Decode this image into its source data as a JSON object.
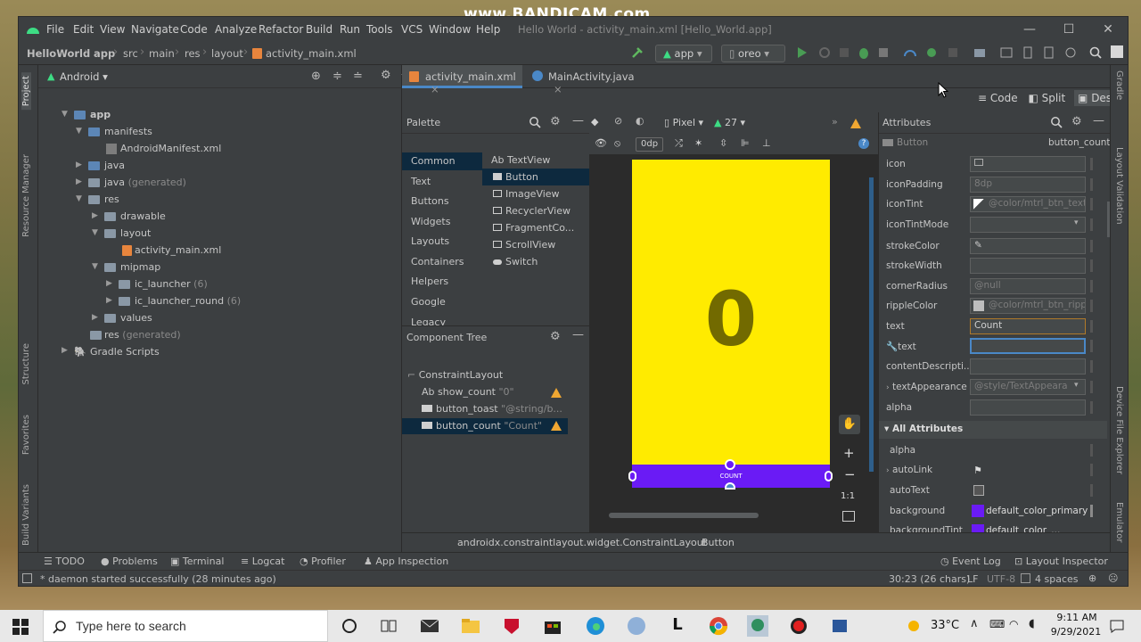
{
  "watermark": "www.BANDICAM.com",
  "window": {
    "title": "Hello World - activity_main.xml [Hello_World.app]"
  },
  "menu": [
    "File",
    "Edit",
    "View",
    "Navigate",
    "Code",
    "Analyze",
    "Refactor",
    "Build",
    "Run",
    "Tools",
    "VCS",
    "Window",
    "Help"
  ],
  "breadcrumb": [
    "HelloWorld",
    "app",
    "src",
    "main",
    "res",
    "layout",
    "activity_main.xml"
  ],
  "run_config": "app",
  "device": "oreo",
  "project": {
    "view": "Android",
    "tree": [
      {
        "label": "app",
        "sub": ""
      },
      {
        "label": "manifests",
        "sub": ""
      },
      {
        "label": "AndroidManifest.xml",
        "sub": ""
      },
      {
        "label": "java",
        "sub": ""
      },
      {
        "label": "java",
        "sub": "(generated)"
      },
      {
        "label": "res",
        "sub": ""
      },
      {
        "label": "drawable",
        "sub": ""
      },
      {
        "label": "layout",
        "sub": ""
      },
      {
        "label": "activity_main.xml",
        "sub": ""
      },
      {
        "label": "mipmap",
        "sub": ""
      },
      {
        "label": "ic_launcher",
        "sub": "(6)"
      },
      {
        "label": "ic_launcher_round",
        "sub": "(6)"
      },
      {
        "label": "values",
        "sub": ""
      },
      {
        "label": "res",
        "sub": "(generated)"
      },
      {
        "label": "Gradle Scripts",
        "sub": ""
      }
    ]
  },
  "left_tool_tabs": [
    "Project",
    "Resource Manager",
    "Structure",
    "Favorites",
    "Build Variants"
  ],
  "right_tool_tabs": [
    "Gradle",
    "Layout Validation",
    "Device File Explorer",
    "Emulator"
  ],
  "editor_tabs": [
    "activity_main.xml",
    "MainActivity.java"
  ],
  "view_modes": [
    "Code",
    "Split",
    "Design"
  ],
  "palette": {
    "title": "Palette",
    "categories": [
      "Common",
      "Text",
      "Buttons",
      "Widgets",
      "Layouts",
      "Containers",
      "Helpers",
      "Google",
      "Legacy"
    ],
    "items": [
      {
        "prefix": "Ab",
        "label": "TextView"
      },
      {
        "prefix": "",
        "label": "Button"
      },
      {
        "prefix": "",
        "label": "ImageView"
      },
      {
        "prefix": "",
        "label": "RecyclerView"
      },
      {
        "prefix": "",
        "label": "FragmentCo..."
      },
      {
        "prefix": "",
        "label": "ScrollView"
      },
      {
        "prefix": "",
        "label": "Switch"
      }
    ]
  },
  "design_toolbar": {
    "device": "Pixel",
    "api": "27",
    "margin": "0dp"
  },
  "component_tree": {
    "title": "Component Tree",
    "rows": [
      {
        "name": "ConstraintLayout",
        "value": ""
      },
      {
        "name": "show_count",
        "value": "\"0\"",
        "prefix": "Ab"
      },
      {
        "name": "button_toast",
        "value": "\"@string/b..."
      },
      {
        "name": "button_count",
        "value": "\"Count\""
      }
    ]
  },
  "preview": {
    "count_text": "0",
    "button_text": "COUNT",
    "colors": {
      "background": "#ffeb00",
      "count": "#726a00",
      "button": "#6a1bf5"
    }
  },
  "zoom_controls": [
    "+",
    "−",
    "1:1"
  ],
  "status_breadcrumb": [
    "androidx.constraintlayout.widget.ConstraintLayout",
    "Button"
  ],
  "attributes": {
    "title": "Attributes",
    "widget": "Button",
    "id": "button_count",
    "rows": [
      {
        "name": "icon",
        "value": ""
      },
      {
        "name": "iconPadding",
        "value": "8dp"
      },
      {
        "name": "iconTint",
        "value": "@color/mtrl_btn_text"
      },
      {
        "name": "iconTintMode",
        "value": ""
      },
      {
        "name": "strokeColor",
        "value": ""
      },
      {
        "name": "strokeWidth",
        "value": ""
      },
      {
        "name": "cornerRadius",
        "value": "@null"
      },
      {
        "name": "rippleColor",
        "value": "@color/mtrl_btn_rippl"
      },
      {
        "name": "text",
        "value": "Count"
      },
      {
        "name": "text",
        "value": ""
      },
      {
        "name": "contentDescripti...",
        "value": ""
      },
      {
        "name": "textAppearance",
        "value": "@style/TextAppeara"
      },
      {
        "name": "alpha",
        "value": ""
      }
    ],
    "all_section": "All Attributes",
    "all_rows": [
      {
        "name": "alpha",
        "value": ""
      },
      {
        "name": "autoLink",
        "value": ""
      },
      {
        "name": "autoText",
        "value": ""
      },
      {
        "name": "background",
        "value": "default_color_primary"
      },
      {
        "name": "backgroundTint",
        "value": "default_color_..."
      }
    ]
  },
  "bottom_tools": [
    "TODO",
    "Problems",
    "Terminal",
    "Logcat",
    "Profiler",
    "App Inspection",
    "Event Log",
    "Layout Inspector"
  ],
  "status": {
    "message": "* daemon started successfully (28 minutes ago)",
    "position": "30:23 (26 chars)",
    "line_sep": "LF",
    "encoding": "UTF-8",
    "indent": "4 spaces"
  },
  "taskbar": {
    "search_placeholder": "Type here to search",
    "temperature": "33°C",
    "time": "9:11 AM",
    "date": "9/29/2021"
  }
}
